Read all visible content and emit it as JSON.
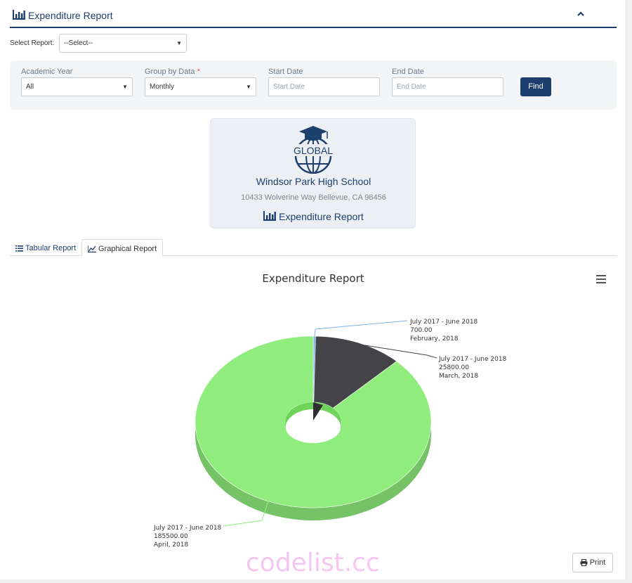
{
  "header": {
    "title": "Expenditure Report",
    "icon": "bar-chart-icon",
    "collapse_icon": "chevron-up-icon"
  },
  "select_report": {
    "label": "Select Report:",
    "value": "--Select--"
  },
  "filters": {
    "academic_year": {
      "label": "Academic Year",
      "value": "All"
    },
    "group_by": {
      "label": "Group by Data",
      "required_mark": "*",
      "value": "Monthly"
    },
    "start_date": {
      "label": "Start Date",
      "placeholder": "Start Date"
    },
    "end_date": {
      "label": "End Date",
      "placeholder": "End Date"
    },
    "find_label": "Find"
  },
  "school": {
    "logo_text": "GLOBAL",
    "name": "Windsor Park High School",
    "address": "10433 Wolverine Way Bellevue, CA 98456",
    "report_title": "Expenditure Report"
  },
  "tabs": [
    {
      "label": "Tabular Report",
      "icon": "list-icon",
      "active": false
    },
    {
      "label": "Graphical Report",
      "icon": "line-chart-icon",
      "active": true
    }
  ],
  "chart_data": {
    "type": "pie",
    "title": "Expenditure Report",
    "variant": "3d-donut",
    "slices": [
      {
        "year": "July 2017 - June 2018",
        "value": 700.0,
        "value_label": "700.00",
        "period": "February, 2018",
        "color": "#7cb5ec"
      },
      {
        "year": "July 2017 - June 2018",
        "value": 25800.0,
        "value_label": "25800.00",
        "period": "March, 2018",
        "color": "#434348"
      },
      {
        "year": "July 2017 - June 2018",
        "value": 185500.0,
        "value_label": "185500.00",
        "period": "April, 2018",
        "color": "#90ed7d"
      }
    ]
  },
  "print_label": "Print",
  "watermark": "codelist.cc",
  "colors": {
    "primary": "#1d3f6e",
    "panel": "#f3f4f5"
  }
}
